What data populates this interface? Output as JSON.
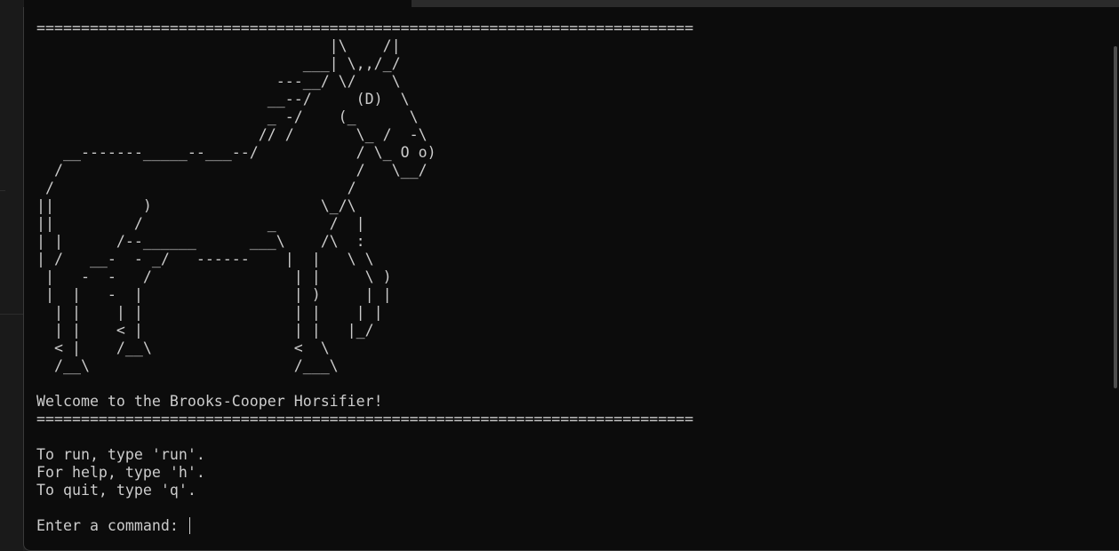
{
  "terminal": {
    "separator": "==========================================================================",
    "horse_art": "                                 |\\    /|\n                              ___| \\,,/_/\n                           ---__/ \\/    \\\n                          __--/     (D)  \\\n                          _ -/    (_      \\\n                         // /       \\_ /  -\\\n   __-------_____--___--/           / \\_ O o)\n  /                                 /   \\__/\n /                                 /\n||          )                   \\_/\\\n||         /              _      /  |\n| |      /--______      ___\\    /\\  :\n| /   __-  - _/   ------    |  |   \\ \\\n |   -  -   /                | |     \\ )\n |  |   -  |                 | )     | |\n  | |    | |                 | |    | |\n  | |    < |                 | |   |_/\n  < |    /__\\                <  \\\n  /__\\                       /___\\",
    "welcome": "Welcome to the Brooks-Cooper Horsifier!",
    "instructions": [
      "To run, type 'run'.",
      "For help, type 'h'.",
      "To quit, type 'q'."
    ],
    "prompt": "Enter a command: "
  }
}
